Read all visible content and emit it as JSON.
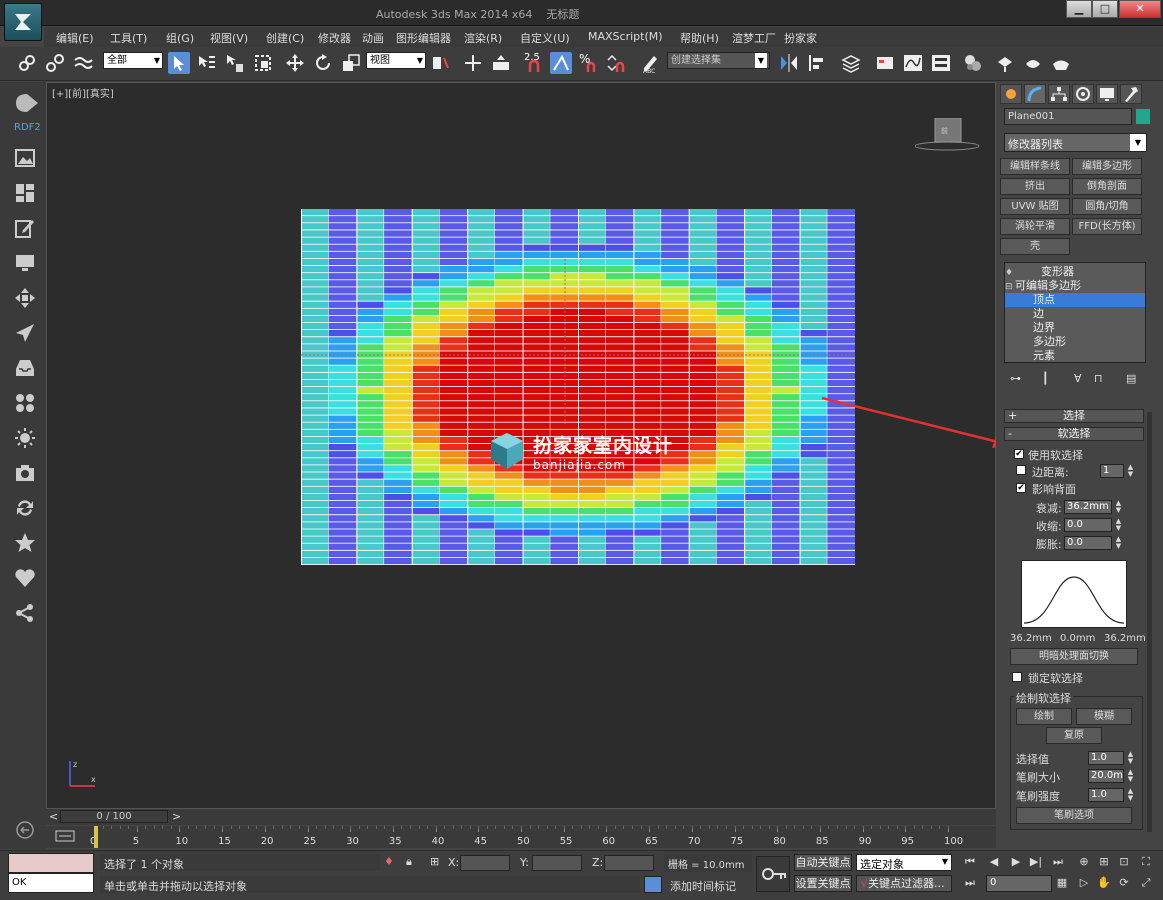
{
  "window": {
    "title": "Autodesk 3ds Max  2014 x64",
    "document": "无标题"
  },
  "menu": [
    "编辑(E)",
    "工具(T)",
    "组(G)",
    "视图(V)",
    "创建(C)",
    "修改器",
    "动画",
    "图形编辑器",
    "渲染(R)",
    "自定义(U)",
    "MAXScript(M)",
    "帮助(H)",
    "渲梦工厂",
    "扮家家"
  ],
  "toolbar": {
    "filter_select": "全部",
    "ref_coord": "视图",
    "snap_label": "2.5",
    "named_selection": "创建选择集"
  },
  "leftbar": {
    "plugin_label": "RDF2"
  },
  "viewport": {
    "label": "[+][前][真实]"
  },
  "watermark": {
    "title": "扮家家室内设计",
    "url": "banjiajia.com"
  },
  "command_panel": {
    "object_name": "Plane001",
    "object_color": "#1fa88e",
    "modifier_list": "修改器列表",
    "modifier_buttons": [
      "编辑样条线",
      "编辑多边形",
      "挤出",
      "倒角剖面",
      "UVW 贴图",
      "圆角/切角",
      "涡轮平滑",
      "FFD(长方体)",
      "壳"
    ],
    "stack": [
      {
        "label": "变形器",
        "selected": false
      },
      {
        "label": "可编辑多边形",
        "selected": false
      },
      {
        "label": "顶点",
        "selected": true
      },
      {
        "label": "边",
        "selected": false
      },
      {
        "label": "边界",
        "selected": false
      },
      {
        "label": "多边形",
        "selected": false
      },
      {
        "label": "元素",
        "selected": false
      }
    ],
    "rollout_selection": "选择",
    "rollout_soft": "软选择",
    "use_soft": {
      "label": "使用软选择",
      "checked": true
    },
    "edge_distance": {
      "label": "边距离:",
      "checked": false,
      "value": "1"
    },
    "affect_backfacing": {
      "label": "影响背面",
      "checked": true
    },
    "falloff": {
      "label": "衰减:",
      "value": "36.2mm"
    },
    "pinch": {
      "label": "收缩:",
      "value": "0.0"
    },
    "bubble": {
      "label": "膨胀:",
      "value": "0.0"
    },
    "curve_labels": [
      "36.2mm",
      "0.0mm",
      "36.2mm"
    ],
    "shaded_face_toggle": "明暗处理面切换",
    "lock_soft": {
      "label": "锁定软选择",
      "checked": false
    },
    "paint_group": "绘制软选择",
    "paint": "绘制",
    "blur": "模糊",
    "revert": "复原",
    "selection_value": {
      "label": "选择值",
      "value": "1.0"
    },
    "brush_size": {
      "label": "笔刷大小",
      "value": "20.0mm"
    },
    "brush_strength": {
      "label": "笔刷强度",
      "value": "1.0"
    },
    "brush_options": "笔刷选项"
  },
  "timeslider": {
    "frame": "0 / 100"
  },
  "ruler": [
    "0",
    "5",
    "10",
    "15",
    "20",
    "25",
    "30",
    "35",
    "40",
    "45",
    "50",
    "55",
    "60",
    "65",
    "70",
    "75",
    "80",
    "85",
    "90",
    "95",
    "100"
  ],
  "status": {
    "listener_output": "OK",
    "selected": "选择了 1 个对象",
    "prompt": "单击或单击并拖动以选择对象",
    "x_label": "X:",
    "y_label": "Y:",
    "z_label": "Z:",
    "grid": "栅格 = 10.0mm",
    "add_time_tag": "添加时间标记",
    "auto_key": "自动关键点",
    "set_key": "设置关键点",
    "key_mode": "选定对象",
    "key_filters": "关键点过滤器...",
    "frame_field": "0"
  },
  "colors": {
    "accent": "#3a7ad8",
    "viewport_bg": "#2c2c2c",
    "annotation_arrow": "#e03434"
  }
}
